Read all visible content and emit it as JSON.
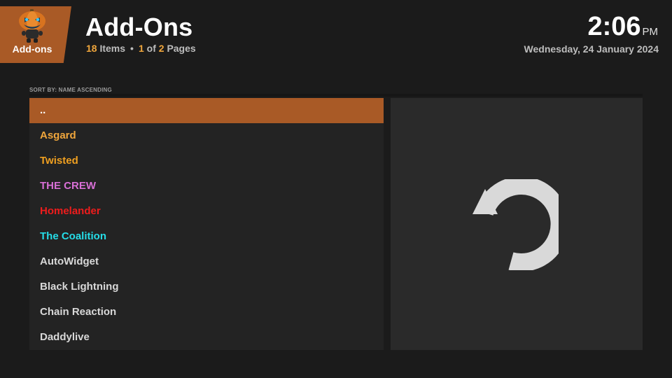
{
  "header": {
    "section_label": "Add-ons",
    "title": "Add-Ons",
    "item_count": "18",
    "items_word": "Items",
    "separator": "•",
    "page_current": "1",
    "page_of": "of",
    "page_total": "2",
    "pages_word": "Pages",
    "time": "2:06",
    "ampm": "PM",
    "date": "Wednesday, 24 January 2024"
  },
  "sort_label": "SORT BY: NAME  ASCENDING",
  "list": {
    "items": [
      {
        "label": "..",
        "color": "#ffffff",
        "selected": true
      },
      {
        "label": "Asgard",
        "color": "#f0a63c"
      },
      {
        "label": "Twisted",
        "color": "#f0a020"
      },
      {
        "label": "THE CREW",
        "color": "#d86fd6"
      },
      {
        "label": "Homelander",
        "color": "#ee1c1c"
      },
      {
        "label": "The Coalition",
        "color": "#25dde8"
      },
      {
        "label": "AutoWidget",
        "color": "#d8d8d8"
      },
      {
        "label": "Black Lightning",
        "color": "#d8d8d8"
      },
      {
        "label": "Chain Reaction",
        "color": "#d8d8d8"
      },
      {
        "label": "Daddylive",
        "color": "#d8d8d8"
      }
    ]
  },
  "preview": {
    "icon": "back-arrow-icon"
  },
  "colors": {
    "accent": "#a95a26",
    "highlight_text": "#f0a63c",
    "background": "#1b1b1b"
  }
}
